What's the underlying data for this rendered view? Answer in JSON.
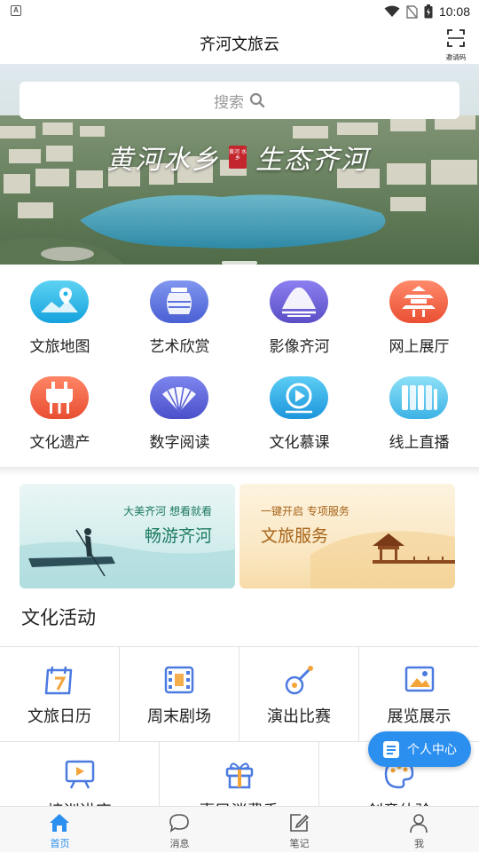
{
  "status_bar": {
    "time": "10:08",
    "left_icon_letter": "A"
  },
  "header": {
    "title": "齐河文旅云",
    "invite_label": "邀请码"
  },
  "banner": {
    "search_placeholder": "搜索",
    "slogan_left": "黄河水乡",
    "slogan_right": "生态齐河",
    "seal_text": "黄河 水乡"
  },
  "grid": {
    "items": [
      {
        "label": "文旅地图",
        "icon": "map-pin-icon",
        "color": "#1fb6e8"
      },
      {
        "label": "艺术欣赏",
        "icon": "vase-icon",
        "color": "#5b74e0"
      },
      {
        "label": "影像齐河",
        "icon": "mountain-image-icon",
        "color": "#6f63d6"
      },
      {
        "label": "网上展厅",
        "icon": "pavilion-icon",
        "color": "#f26b4d"
      },
      {
        "label": "文化遗产",
        "icon": "bronze-vessel-icon",
        "color": "#f2684a"
      },
      {
        "label": "数字阅读",
        "icon": "fan-book-icon",
        "color": "#5a62d8"
      },
      {
        "label": "文化慕课",
        "icon": "video-play-icon",
        "color": "#2aaee8"
      },
      {
        "label": "线上直播",
        "icon": "live-stream-icon",
        "color": "#4fc3ea"
      }
    ]
  },
  "promo": {
    "card1": {
      "subtitle": "大美齐河 想看就看",
      "title": "畅游齐河"
    },
    "card2": {
      "subtitle": "一键开启 专项服务",
      "title": "文旅服务"
    }
  },
  "activities": {
    "section_title": "文化活动",
    "row1": [
      {
        "label": "文旅日历",
        "icon": "calendar-icon"
      },
      {
        "label": "周末剧场",
        "icon": "film-reel-icon"
      },
      {
        "label": "演出比赛",
        "icon": "guitar-icon"
      },
      {
        "label": "展览展示",
        "icon": "picture-frame-icon"
      }
    ],
    "row2": [
      {
        "label": "培训讲座",
        "icon": "presentation-board-icon"
      },
      {
        "label": "惠民消费季",
        "icon": "gift-icon"
      },
      {
        "label": "创意体验",
        "icon": "palette-icon"
      }
    ]
  },
  "fab": {
    "label": "个人中心"
  },
  "tabbar": {
    "tabs": [
      {
        "label": "首页",
        "active": true
      },
      {
        "label": "消息"
      },
      {
        "label": "笔记"
      },
      {
        "label": "我"
      }
    ]
  },
  "colors": {
    "accent": "#2b8ff0"
  }
}
